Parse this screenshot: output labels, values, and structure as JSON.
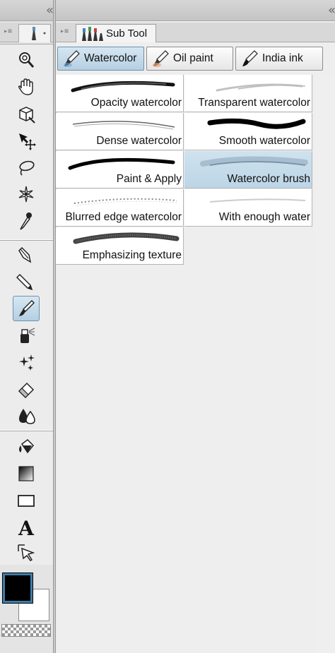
{
  "left_column": {
    "collapse_glyph": "«",
    "tools_group_1": [
      {
        "name": "zoom-tool",
        "icon": "magnifier-icon"
      },
      {
        "name": "hand-tool",
        "icon": "hand-icon"
      },
      {
        "name": "object-tool",
        "icon": "cube-icon"
      },
      {
        "name": "move-tool",
        "icon": "move-arrow-icon"
      },
      {
        "name": "lasso-tool",
        "icon": "lasso-icon"
      },
      {
        "name": "magic-wand-tool",
        "icon": "sparkle-icon"
      },
      {
        "name": "eyedropper-tool",
        "icon": "eyedropper-icon"
      }
    ],
    "tools_group_2": [
      {
        "name": "pen-tool",
        "icon": "pen-nib-icon"
      },
      {
        "name": "pencil-tool",
        "icon": "pencil-icon"
      },
      {
        "name": "brush-tool",
        "icon": "brush-icon",
        "selected": true
      },
      {
        "name": "airbrush-tool",
        "icon": "airbrush-icon"
      },
      {
        "name": "decoration-tool",
        "icon": "decoration-icon"
      },
      {
        "name": "eraser-tool",
        "icon": "eraser-icon"
      },
      {
        "name": "blend-tool",
        "icon": "drops-icon"
      }
    ],
    "tools_group_3": [
      {
        "name": "fill-tool",
        "icon": "bucket-icon"
      },
      {
        "name": "gradient-tool",
        "icon": "gradient-icon"
      },
      {
        "name": "figure-tool",
        "icon": "rectangle-icon"
      },
      {
        "name": "text-tool",
        "icon": "text-a-icon"
      },
      {
        "name": "operation-tool",
        "icon": "select-arrow-icon"
      }
    ],
    "colors": {
      "main": "#000000",
      "sub": "#ffffff"
    }
  },
  "sub_tool": {
    "tab_label": "Sub Tool",
    "groups": [
      {
        "label": "Watercolor",
        "active": true
      },
      {
        "label": "Oil paint",
        "active": false
      },
      {
        "label": "India ink",
        "active": false
      }
    ],
    "presets": [
      {
        "label": "Opacity watercolor",
        "stroke": "dark-taper"
      },
      {
        "label": "Transparent watercolor",
        "stroke": "light-taper"
      },
      {
        "label": "Dense watercolor",
        "stroke": "thin-gray"
      },
      {
        "label": "Smooth watercolor",
        "stroke": "bold-black"
      },
      {
        "label": "Paint & Apply",
        "stroke": "medium-black"
      },
      {
        "label": "Watercolor brush",
        "stroke": "soft-watercolor",
        "selected": true
      },
      {
        "label": "Blurred edge watercolor",
        "stroke": "dotted"
      },
      {
        "label": "With enough water",
        "stroke": "faint"
      },
      {
        "label": "Emphasizing texture",
        "stroke": "textured"
      }
    ]
  },
  "theme": {
    "selection_blue": "#b6cfe2",
    "panel_bg": "#eeeeee",
    "border": "#a8a8a8"
  }
}
